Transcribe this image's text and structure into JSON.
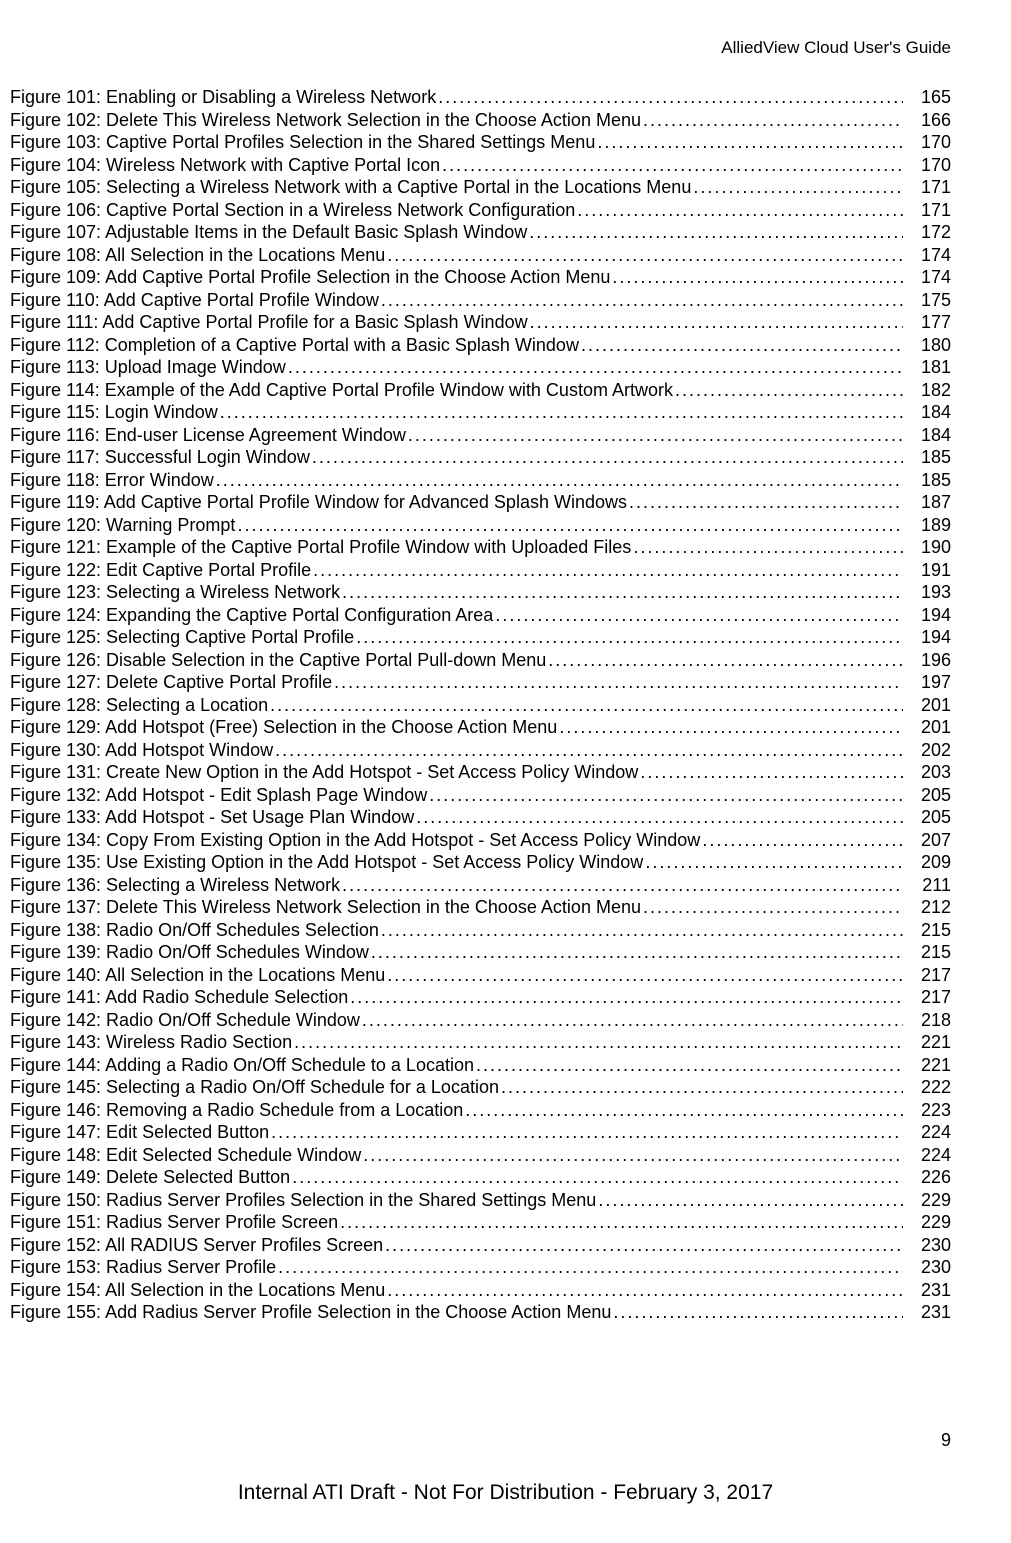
{
  "header": {
    "doc_title": "AlliedView Cloud User's Guide"
  },
  "entries": [
    {
      "label": "Figure 101: Enabling or Disabling a Wireless Network ",
      "page": "165"
    },
    {
      "label": "Figure 102: Delete This Wireless Network Selection in the Choose Action Menu ",
      "page": "166"
    },
    {
      "label": "Figure 103: Captive Portal Profiles Selection in the Shared Settings Menu",
      "page": "170"
    },
    {
      "label": "Figure 104: Wireless Network with Captive Portal Icon",
      "page": "170"
    },
    {
      "label": "Figure 105: Selecting a Wireless Network with a Captive Portal in the Locations Menu ",
      "page": "171"
    },
    {
      "label": "Figure 106: Captive Portal Section in a Wireless Network Configuration",
      "page": "171"
    },
    {
      "label": "Figure 107: Adjustable Items in the Default Basic Splash Window",
      "page": "172"
    },
    {
      "label": "Figure 108: All Selection in the Locations Menu ",
      "page": "174"
    },
    {
      "label": "Figure 109: Add Captive Portal Profile Selection in the Choose Action Menu ",
      "page": "174"
    },
    {
      "label": "Figure 110: Add Captive Portal Profile Window ",
      "page": "175"
    },
    {
      "label": "Figure 111: Add Captive Portal Profile for a Basic Splash Window ",
      "page": "177"
    },
    {
      "label": "Figure 112: Completion of a Captive Portal with a Basic Splash Window",
      "page": "180"
    },
    {
      "label": "Figure 113: Upload Image Window ",
      "page": "181"
    },
    {
      "label": "Figure 114: Example of the Add Captive Portal Profile Window with Custom Artwork ",
      "page": "182"
    },
    {
      "label": "Figure 115: Login Window",
      "page": "184"
    },
    {
      "label": "Figure 116: End-user License Agreement Window ",
      "page": "184"
    },
    {
      "label": "Figure 117: Successful Login Window ",
      "page": "185"
    },
    {
      "label": "Figure 118: Error Window",
      "page": "185"
    },
    {
      "label": "Figure 119: Add Captive Portal Profile Window for Advanced Splash Windows",
      "page": "187"
    },
    {
      "label": "Figure 120: Warning Prompt ",
      "page": "189"
    },
    {
      "label": "Figure 121: Example of the Captive Portal Profile Window with Uploaded Files ",
      "page": "190"
    },
    {
      "label": "Figure 122: Edit Captive Portal Profile ",
      "page": "191"
    },
    {
      "label": "Figure 123: Selecting a Wireless Network",
      "page": "193"
    },
    {
      "label": "Figure 124: Expanding the Captive Portal Configuration Area",
      "page": "194"
    },
    {
      "label": "Figure 125: Selecting Captive Portal Profile",
      "page": "194"
    },
    {
      "label": "Figure 126: Disable Selection in the Captive Portal Pull-down Menu ",
      "page": "196"
    },
    {
      "label": "Figure 127: Delete Captive Portal Profile ",
      "page": "197"
    },
    {
      "label": "Figure 128: Selecting a Location",
      "page": "201"
    },
    {
      "label": "Figure 129: Add Hotspot (Free) Selection in the Choose Action Menu",
      "page": "201"
    },
    {
      "label": "Figure 130: Add Hotspot Window",
      "page": "202"
    },
    {
      "label": "Figure 131: Create New Option in the Add Hotspot - Set Access Policy Window",
      "page": "203"
    },
    {
      "label": "Figure 132: Add Hotspot - Edit Splash Page Window",
      "page": "205"
    },
    {
      "label": "Figure 133: Add Hotspot - Set Usage Plan Window",
      "page": "205"
    },
    {
      "label": "Figure 134: Copy From Existing Option in the Add Hotspot - Set Access Policy Window ",
      "page": "207"
    },
    {
      "label": "Figure 135: Use Existing Option in the Add Hotspot - Set Access Policy Window",
      "page": "209"
    },
    {
      "label": "Figure 136: Selecting a Wireless Network",
      "page": "211"
    },
    {
      "label": "Figure 137: Delete This Wireless Network Selection in the Choose Action Menu ",
      "page": "212"
    },
    {
      "label": "Figure 138: Radio On/Off Schedules Selection",
      "page": "215"
    },
    {
      "label": "Figure 139: Radio On/Off Schedules Window",
      "page": "215"
    },
    {
      "label": "Figure 140: All Selection in the Locations Menu ",
      "page": "217"
    },
    {
      "label": "Figure 141: Add Radio Schedule Selection",
      "page": "217"
    },
    {
      "label": "Figure 142: Radio On/Off Schedule Window",
      "page": "218"
    },
    {
      "label": "Figure 143: Wireless Radio Section ",
      "page": "221"
    },
    {
      "label": "Figure 144: Adding a Radio On/Off Schedule to a Location",
      "page": "221"
    },
    {
      "label": "Figure 145: Selecting a Radio On/Off Schedule for a Location",
      "page": "222"
    },
    {
      "label": "Figure 146: Removing a Radio Schedule from a Location",
      "page": "223"
    },
    {
      "label": "Figure 147: Edit Selected Button",
      "page": "224"
    },
    {
      "label": "Figure 148: Edit Selected Schedule Window ",
      "page": "224"
    },
    {
      "label": "Figure 149: Delete Selected Button",
      "page": "226"
    },
    {
      "label": "Figure 150: Radius Server Profiles Selection in the Shared Settings Menu ",
      "page": "229"
    },
    {
      "label": "Figure 151: Radius Server Profile Screen",
      "page": "229"
    },
    {
      "label": "Figure 152: All RADIUS Server Profiles Screen",
      "page": "230"
    },
    {
      "label": "Figure 153: Radius Server Profile ",
      "page": "230"
    },
    {
      "label": "Figure 154: All Selection in the Locations Menu ",
      "page": "231"
    },
    {
      "label": "Figure 155: Add Radius Server Profile Selection in the Choose Action Menu",
      "page": "231"
    }
  ],
  "footer": {
    "page_number": "9",
    "note": "Internal ATI Draft - Not For Distribution - February 3, 2017"
  }
}
